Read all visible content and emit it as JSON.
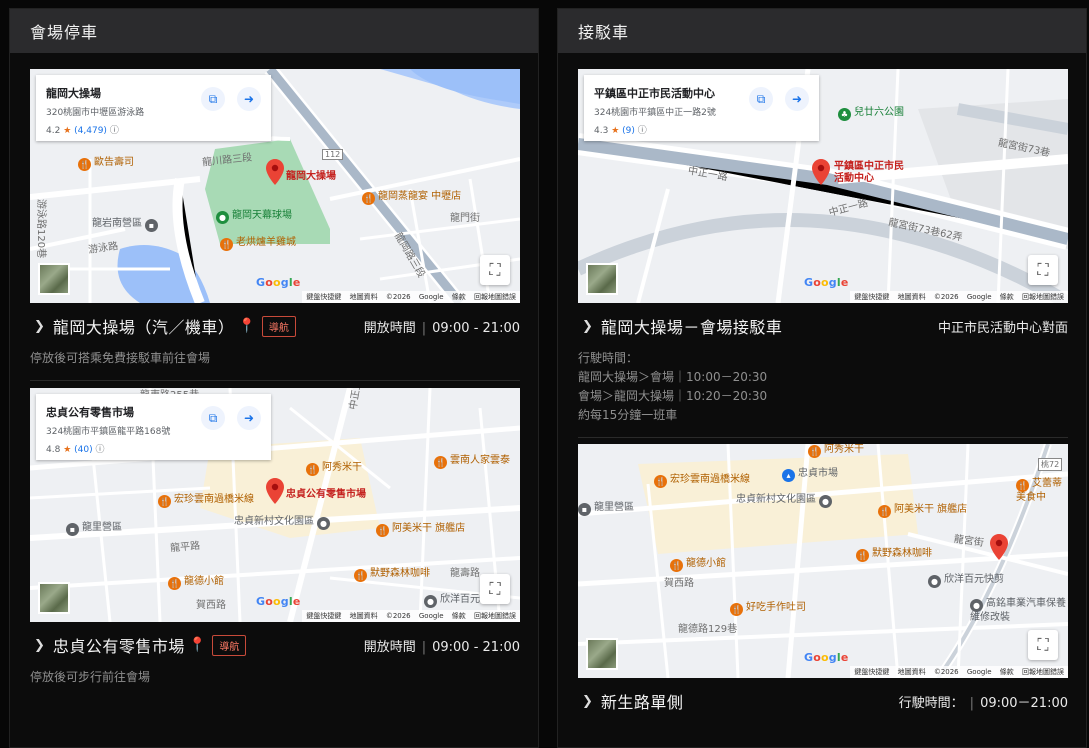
{
  "left_panel": {
    "title": "會場停車",
    "cards": [
      {
        "map": {
          "place_name": "龍岡大操場",
          "address": "320桃園市中壢區游泳路",
          "rating": "4.2",
          "review_count": "(4,479)",
          "labels": {
            "pin": "龍岡大操場",
            "poi1": "歐告壽司",
            "poi2": "龍岡天幕球場",
            "poi3": "老烘爐羊雞城",
            "poi4": "龍岡蒸龍宴 中壢店",
            "poi5": "龍岩南營區",
            "road1": "龍川路三段",
            "road2": "游泳路120巷",
            "road3": "游泳路",
            "road4": "龍門街",
            "road5": "龍岡路三段",
            "road_num": "112"
          }
        },
        "title": "龍岡大操場（汽／機車）",
        "nav_label": "導航",
        "hours_label": "開放時間",
        "hours_value": "09:00 - 21:00",
        "description": "停放後可搭乘免費接駁車前往會場"
      },
      {
        "map": {
          "place_name": "忠貞公有零售市場",
          "address": "324桃園市平鎮區龍平路168號",
          "rating": "4.8",
          "review_count": "(40)",
          "labels": {
            "pin": "忠貞公有零售市場",
            "poi1": "阿秀米干",
            "poi2": "雲南人家雲泰",
            "poi3": "宏珍雲南過橋米線",
            "poi4": "忠貞新村文化園區",
            "poi5": "阿美米干 旗艦店",
            "poi6": "龍里營區",
            "poi7": "龍德小館",
            "poi8": "默野森林咖啡",
            "poi9": "欣洋百元",
            "road1": "龍東路255巷",
            "road2": "中正五路",
            "road3": "龍平路",
            "road4": "賀西路",
            "road5": "龍壽路"
          }
        },
        "title": "忠貞公有零售市場",
        "nav_label": "導航",
        "hours_label": "開放時間",
        "hours_value": "09:00 - 21:00",
        "description": "停放後可步行前往會場"
      }
    ]
  },
  "right_panel": {
    "title": "接駁車",
    "cards": [
      {
        "map": {
          "place_name": "平鎮區中正市民活動中心",
          "address": "324桃園市平鎮區中正一路2號",
          "rating": "4.3",
          "review_count": "(9)",
          "labels": {
            "pin": "平鎮區中正市民活動中心",
            "poi1": "兒廿六公園",
            "road1": "中正一路",
            "road2": "中正一路",
            "road3": "龍宮街73巷62弄",
            "road4": "龍宮街73巷"
          }
        },
        "title": "龍岡大操場－會場接駁車",
        "location_text": "中正市民活動中心對面",
        "schedule_lines": [
          "行駛時間：",
          "龍岡大操場＞會場｜10:00－20:30",
          "會場＞龍岡大操場｜10:20－20:30",
          "約每15分鐘一班車"
        ]
      },
      {
        "map": {
          "labels": {
            "poi1": "阿秀米干",
            "poi2": "宏珍雲南過橋米線",
            "poi3": "忠貞市場",
            "poi4": "艾蕾蒂美食中",
            "poi5": "龍里營區",
            "poi6": "忠貞新村文化園區",
            "poi7": "阿美米干 旗艦店",
            "poi8": "龍德小館",
            "poi9": "默野森林咖啡",
            "poi10": "欣洋百元快剪",
            "poi11": "好吃手作吐司",
            "poi12": "高銘車業汽車保養維修改裝",
            "road1": "龍宮街",
            "road2": "賀西路",
            "road3": "龍德路129巷",
            "road_num": "桃72"
          }
        },
        "title": "新生路單側",
        "hours_label": "行駛時間：",
        "hours_value": "09:00－21:00"
      }
    ]
  },
  "map_common": {
    "google": "Google",
    "attribution": "鍵盤快捷鍵 地圖資料 ©2026 Google 條款 回報地圖錯誤"
  }
}
